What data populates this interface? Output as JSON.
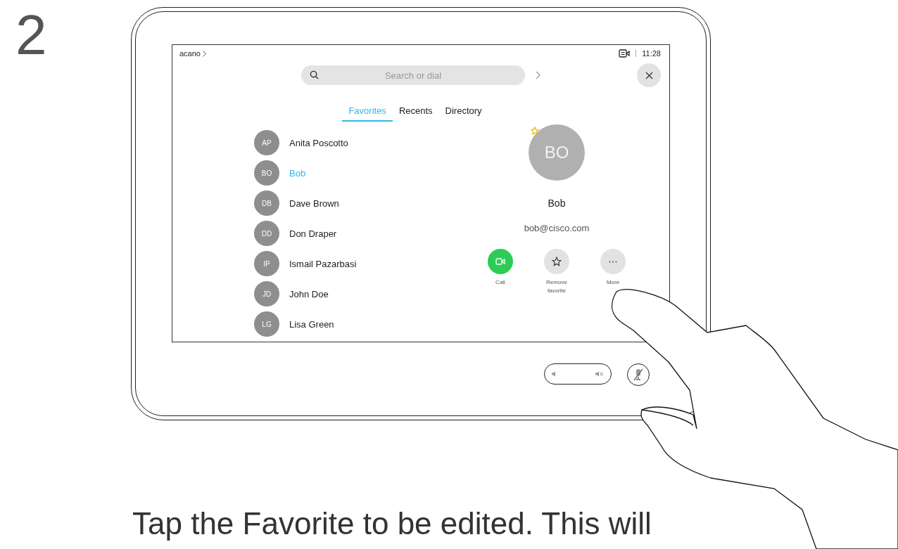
{
  "step": "2",
  "screen": {
    "header": {
      "brand": "acano",
      "time": "11:28"
    },
    "search": {
      "placeholder": "Search or dial"
    },
    "tabs": [
      {
        "label": "Favorites",
        "selected": true
      },
      {
        "label": "Recents",
        "selected": false
      },
      {
        "label": "Directory",
        "selected": false
      }
    ],
    "contacts": [
      {
        "initials": "AP",
        "name": "Anita Poscotto",
        "selected": false
      },
      {
        "initials": "BO",
        "name": "Bob",
        "selected": true
      },
      {
        "initials": "DB",
        "name": "Dave Brown",
        "selected": false
      },
      {
        "initials": "DD",
        "name": "Don Draper",
        "selected": false
      },
      {
        "initials": "IP",
        "name": "Ismail Pazarbasi",
        "selected": false
      },
      {
        "initials": "JD",
        "name": "John Doe",
        "selected": false
      },
      {
        "initials": "LG",
        "name": "Lisa Green",
        "selected": false
      }
    ],
    "detail": {
      "initials": "BO",
      "favorite": true,
      "name": "Bob",
      "email": "bob@cisco.com",
      "actions": [
        {
          "kind": "call",
          "label": "Call"
        },
        {
          "kind": "favorite",
          "label": "Remove favorite"
        },
        {
          "kind": "more",
          "label": "More"
        }
      ]
    }
  },
  "caption": "Tap the Favorite to be edited. This will"
}
